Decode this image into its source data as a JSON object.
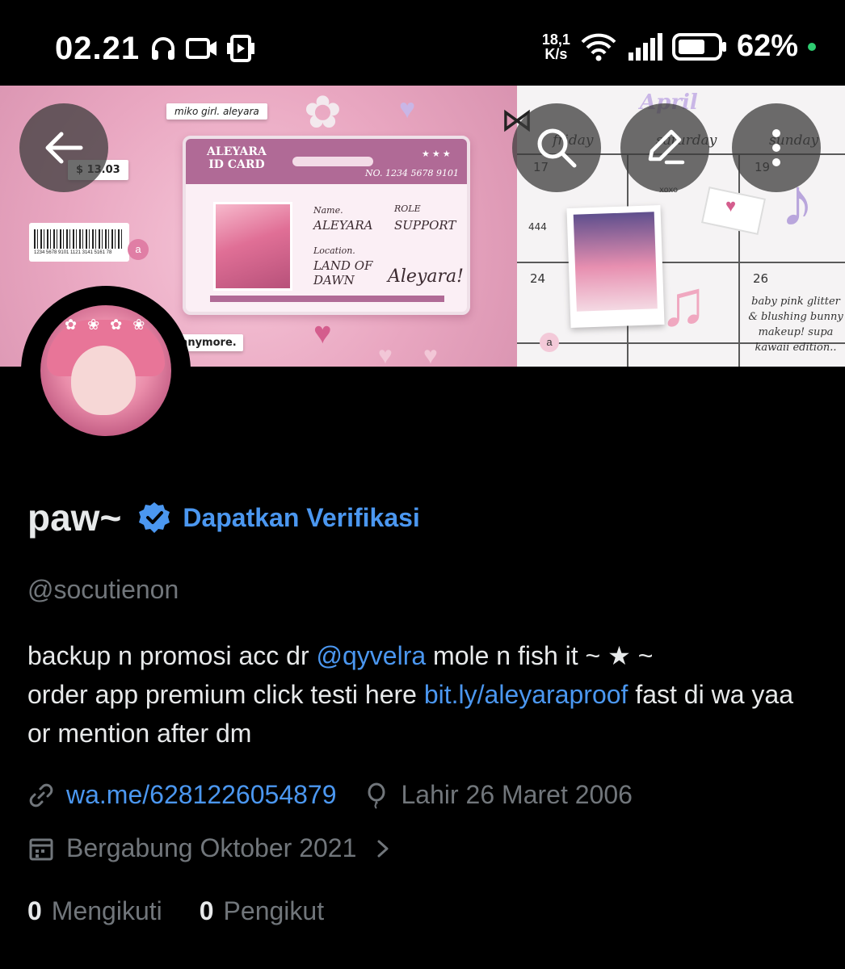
{
  "status_bar": {
    "time": "02.21",
    "net_speed_value": "18,1",
    "net_speed_unit": "K/s",
    "battery_percent": "62%",
    "icons_left": [
      "headset-icon",
      "video-camera-icon",
      "screen-record-icon"
    ],
    "icons_right": [
      "wifi-icon",
      "signal-icon",
      "battery-icon",
      "notification-dot"
    ]
  },
  "banner": {
    "tag_top": "miko girl. aleyara",
    "price_tag": "$ 13.03",
    "barcode_digits": "1234 5678 9101 1121 3141 5161 78",
    "bottom_tag": "te anymore.",
    "id_card": {
      "title": "ALEYARA\nID CARD",
      "number": "NO. 1234 5678 9101",
      "name_label": "Name.",
      "name_value": "ALEYARA",
      "role_label": "ROLE",
      "role_value": "SUPPORT",
      "location_label": "Location.",
      "location_value": "LAND OF\nDAWN",
      "signature": "Aleyara!"
    },
    "calendar": {
      "month": "April",
      "days": [
        "friday",
        "saturday",
        "sunday"
      ],
      "numbers": [
        "17",
        "19",
        "444",
        "24",
        "26"
      ],
      "xoxo": "xoxo",
      "note": "baby pink glitter & blushing bunny makeup! supa kawaii edition..",
      "a_marks": [
        "a",
        "a"
      ]
    }
  },
  "actions": {
    "back": "arrow-left-icon",
    "search": "search-icon",
    "edit": "edit-icon",
    "more": "more-vertical-icon"
  },
  "profile": {
    "display_name": "paw~",
    "verify_text": "Dapatkan Verifikasi",
    "handle": "@socutienon",
    "bio_line1_a": "backup n promosi acc dr ",
    "bio_mention": "@qyvelra",
    "bio_line1_b": " mole n fish it  ~  ★  ~",
    "bio_line2_a": "order app premium click testi here ",
    "bio_link": "bit.ly/aleyaraproof",
    "bio_line2_b": "  fast di wa yaa or mention after dm",
    "website": "wa.me/6281226054879",
    "birthday": "Lahir 26 Maret 2006",
    "joined": "Bergabung Oktober 2021",
    "following_count": "0",
    "following_label": "Mengikuti",
    "followers_count": "0",
    "followers_label": "Pengikut"
  },
  "colors": {
    "background": "#000000",
    "text_primary": "#e7e9ea",
    "text_secondary": "#71767b",
    "link": "#4b97f0",
    "verify_badge": "#4b97f0",
    "status_dot": "#2ecc71"
  }
}
